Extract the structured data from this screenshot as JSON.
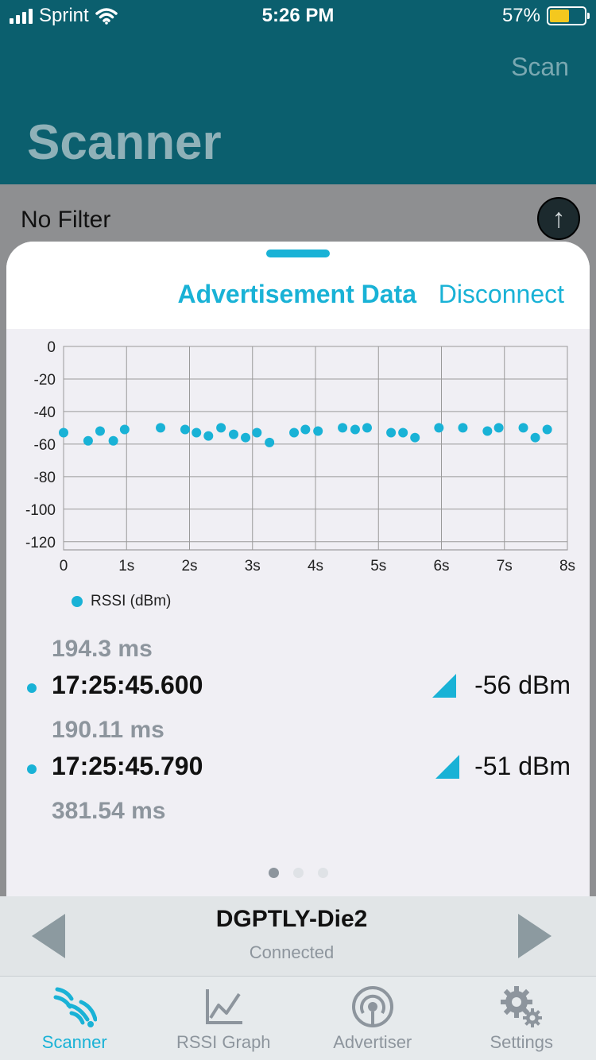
{
  "status": {
    "carrier": "Sprint",
    "time": "5:26 PM",
    "battery_pct": "57%",
    "battery_level": 0.57
  },
  "header": {
    "scan_label": "Scan",
    "title": "Scanner"
  },
  "filter": {
    "label": "No Filter",
    "sort_icon": "↑"
  },
  "sheet": {
    "tabs": [
      {
        "label": "Advertisement Data",
        "active": true
      },
      {
        "label": "Disconnect",
        "active": false
      }
    ],
    "packets": [
      {
        "interval_before": "194.3 ms",
        "time": "17:25:45.600",
        "rssi": "-56 dBm"
      },
      {
        "interval_before": "190.11 ms",
        "time": "17:25:45.790",
        "rssi": "-51 dBm"
      }
    ],
    "interval_after": "381.54 ms",
    "pager": {
      "count": 3,
      "active": 0
    }
  },
  "chart_data": {
    "type": "scatter",
    "series": [
      {
        "name": "RSSI (dBm)",
        "color": "#19b2d6",
        "points": [
          [
            0.0,
            -53
          ],
          [
            0.39,
            -58
          ],
          [
            0.58,
            -52
          ],
          [
            0.79,
            -58
          ],
          [
            0.97,
            -51
          ],
          [
            1.54,
            -50
          ],
          [
            1.93,
            -51
          ],
          [
            2.11,
            -53
          ],
          [
            2.3,
            -55
          ],
          [
            2.5,
            -50
          ],
          [
            2.7,
            -54
          ],
          [
            2.89,
            -56
          ],
          [
            3.07,
            -53
          ],
          [
            3.27,
            -59
          ],
          [
            3.66,
            -53
          ],
          [
            3.84,
            -51
          ],
          [
            4.04,
            -52
          ],
          [
            4.43,
            -50
          ],
          [
            4.63,
            -51
          ],
          [
            4.82,
            -50
          ],
          [
            5.2,
            -53
          ],
          [
            5.39,
            -53
          ],
          [
            5.58,
            -56
          ],
          [
            5.96,
            -50
          ],
          [
            6.34,
            -50
          ],
          [
            6.73,
            -52
          ],
          [
            6.91,
            -50
          ],
          [
            7.3,
            -50
          ],
          [
            7.49,
            -56
          ],
          [
            7.68,
            -51
          ]
        ]
      }
    ],
    "xlim": [
      0,
      8
    ],
    "ylim": [
      -125,
      0
    ],
    "x_ticks": [
      0,
      1,
      2,
      3,
      4,
      5,
      6,
      7,
      8
    ],
    "x_tick_labels": [
      "0",
      "1s",
      "2s",
      "3s",
      "4s",
      "5s",
      "6s",
      "7s",
      "8s"
    ],
    "y_ticks": [
      0,
      -20,
      -40,
      -60,
      -80,
      -100,
      -120
    ],
    "y_tick_labels": [
      "0",
      "-20",
      "-40",
      "-60",
      "-80",
      "-100",
      "-120"
    ],
    "grid": true,
    "legend": "bottom-left"
  },
  "device": {
    "name": "DGPTLY-Die2",
    "status": "Connected"
  },
  "tabbar": {
    "items": [
      {
        "label": "Scanner",
        "icon": "scanner-wave-icon",
        "active": true
      },
      {
        "label": "RSSI Graph",
        "icon": "line-graph-icon",
        "active": false
      },
      {
        "label": "Advertiser",
        "icon": "broadcast-icon",
        "active": false
      },
      {
        "label": "Settings",
        "icon": "gear-icon",
        "active": false
      }
    ]
  },
  "colors": {
    "header_bg": "#0b5f6e",
    "accent": "#19b2d6",
    "muted_text": "#8d959d"
  }
}
